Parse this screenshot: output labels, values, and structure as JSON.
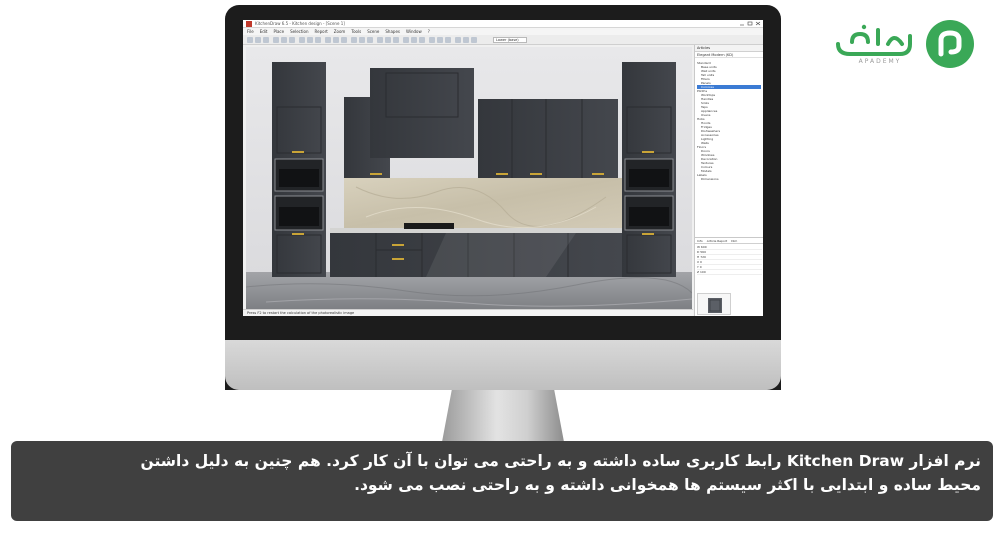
{
  "brand": {
    "name": "آپادمی",
    "tagline": "APADEMY",
    "accent": "#3aa857"
  },
  "monitor": {
    "app": {
      "title_text": "KitchenDraw 6.5 - Kitchen design - [Scene 1]",
      "menu": [
        "File",
        "Edit",
        "Place",
        "Selection",
        "Report",
        "Zoom",
        "Tools",
        "Scene",
        "Shapes",
        "Window",
        "?"
      ],
      "toolbar_combo": "Lower (base)",
      "status_text": "Press F2 to restart the calculation of the photorealistic image",
      "panel": {
        "title": "Articles",
        "subtitle": "Elegant Modern (KD)",
        "tree": [
          "Standard",
          "Base units",
          "Wall units",
          "Tall units",
          "Fillers",
          "Panels",
          "Cornices",
          "Plinths",
          "Worktops",
          "Handles",
          "Sinks",
          "Taps",
          "Appliances",
          "Ovens",
          "Hobs",
          "Hoods",
          "Fridges",
          "Dishwashers",
          "Accessories",
          "Lighting",
          "Walls",
          "Floors",
          "Doors",
          "Windows",
          "Decoration",
          "Textures",
          "Colours",
          "Models",
          "Labels",
          "Dimensions"
        ],
        "selected_index": 6,
        "props_tabs": [
          "Info",
          "Article Report",
          "Dim"
        ],
        "props_rows": [
          "W 600",
          "D 560",
          "H 720",
          "X 0",
          "Y 0",
          "Z 100"
        ]
      }
    }
  },
  "caption": {
    "line1": "نرم افزار Kitchen Draw رابط کاربری ساده داشته و به راحتی می توان با آن کار کرد. هم چنین به دلیل داشتن",
    "line2": "محیط ساده و ابتدایی با اکثر سیستم ها همخوانی داشته و به راحتی نصب می شود."
  },
  "colors": {
    "caption_bg": "#404040",
    "cabinet": "#3a3d42",
    "backsplash": "#cfc8b4",
    "floor": "#8f9093"
  }
}
